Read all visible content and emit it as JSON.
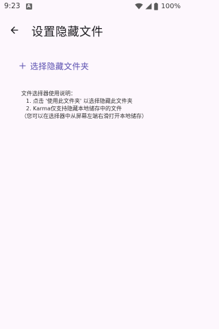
{
  "status_bar": {
    "time": "9:23",
    "notification_glyph": "A",
    "battery_percent": "100%"
  },
  "app_bar": {
    "title": "设置隐藏文件",
    "back_icon": "arrow-back-icon"
  },
  "select_button": {
    "label": "选择隐藏文件夹",
    "icon": "plus-icon",
    "color": "#5a4fb0"
  },
  "instructions": {
    "heading": "文件选择器使用说明：",
    "item1": "1. 点击 '使用此文件夹' 以选择隐藏此文件夹",
    "item2": "2. Karma仅支持隐藏本地储存中的文件",
    "note": "（您可以在选择器中从屏幕左端右滑打开本地储存）"
  },
  "colors": {
    "background": "#fdf7fd",
    "accent": "#5a4fb0",
    "text": "#1c1b1f"
  }
}
